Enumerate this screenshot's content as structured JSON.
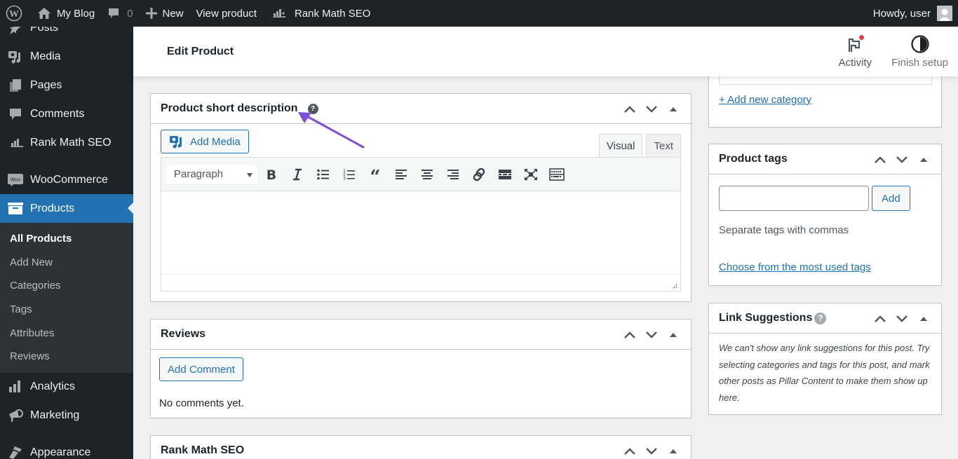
{
  "adminbar": {
    "site_name": "My Blog",
    "comments_count": "0",
    "new_label": "New",
    "view_product": "View product",
    "rank_math": "Rank Math SEO",
    "greeting": "Howdy, user"
  },
  "sidebar": {
    "items": [
      {
        "label": "Posts",
        "icon": "pin-icon"
      },
      {
        "label": "Media",
        "icon": "media-icon"
      },
      {
        "label": "Pages",
        "icon": "pages-icon"
      },
      {
        "label": "Comments",
        "icon": "comment-icon"
      },
      {
        "label": "Rank Math SEO",
        "icon": "rank-math-icon"
      },
      {
        "label": "WooCommerce",
        "icon": "woo-icon"
      },
      {
        "label": "Products",
        "icon": "archive-icon"
      },
      {
        "label": "Analytics",
        "icon": "bar-chart-icon"
      },
      {
        "label": "Marketing",
        "icon": "megaphone-icon"
      },
      {
        "label": "Appearance",
        "icon": "brush-icon"
      }
    ],
    "woo_badge": "Woo",
    "submenu": [
      "All Products",
      "Add New",
      "Categories",
      "Tags",
      "Attributes",
      "Reviews"
    ]
  },
  "header": {
    "title": "Edit Product",
    "activity": "Activity",
    "finish_setup": "Finish setup"
  },
  "short_description": {
    "title": "Product short description",
    "help": "?",
    "add_media": "Add Media",
    "tab_visual": "Visual",
    "tab_text": "Text",
    "format": "Paragraph"
  },
  "reviews": {
    "title": "Reviews",
    "add_comment": "Add Comment",
    "empty": "No comments yet."
  },
  "rank_math_box": {
    "title": "Rank Math SEO"
  },
  "categories": {
    "add_new": "+ Add new category"
  },
  "tags": {
    "title": "Product tags",
    "input_value": "",
    "add_button": "Add",
    "hint": "Separate tags with commas",
    "choose_link": "Choose from the most used tags"
  },
  "link_suggestions": {
    "title": "Link Suggestions",
    "help": "?",
    "message": "We can't show any link suggestions for this post. Try selecting categories and tags for this post, and mark other posts as Pillar Content to make them show up here."
  },
  "colors": {
    "accent": "#2271b1",
    "adminbar": "#1d2327",
    "annotation_arrow": "#7b4fd6"
  }
}
